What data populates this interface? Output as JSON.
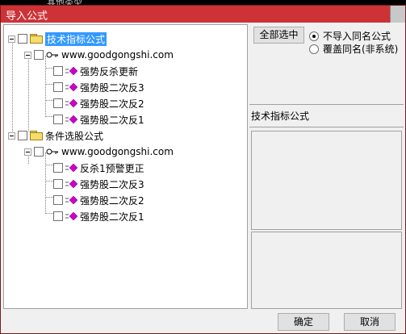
{
  "background": {
    "partial_text": "其他类型"
  },
  "window": {
    "title": "导入公式"
  },
  "tree": {
    "groups": [
      {
        "label": "技术指标公式",
        "selected": true,
        "site": "www.goodgongshi.com",
        "items": [
          "强势反杀更新",
          "强势股二次反3",
          "强势股二次反2",
          "强势股二次反1"
        ]
      },
      {
        "label": "条件选股公式",
        "selected": false,
        "site": "www.goodgongshi.com",
        "items": [
          "反杀1预警更正",
          "强势股二次反3",
          "强势股二次反2",
          "强势股二次反1"
        ]
      }
    ]
  },
  "options": {
    "select_all_label": "全部选中",
    "radios": [
      {
        "label": "不导入同名公式",
        "checked": true
      },
      {
        "label": "覆盖同名(非系统)",
        "checked": false
      }
    ]
  },
  "info": {
    "type_label": "技术指标公式"
  },
  "footer": {
    "ok_label": "确定",
    "cancel_label": "取消"
  },
  "colors": {
    "titlebar": "#cc3236",
    "selection": "#3399ff",
    "formula_icon": "#cc00cc"
  }
}
